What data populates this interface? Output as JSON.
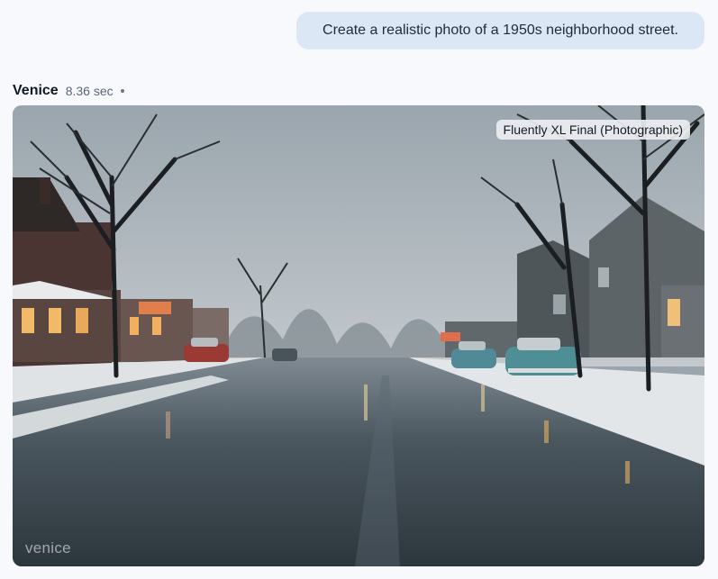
{
  "prompt": {
    "text": "Create a realistic photo of a 1950s neighborhood street."
  },
  "response": {
    "model": "Venice",
    "time": "8.36 sec",
    "image": {
      "badge": "Fluently XL Final (Photographic)",
      "watermark": "venice",
      "description_icon": "generated-photo"
    }
  },
  "colors": {
    "page_bg": "#f7f9fd",
    "bubble_bg": "#dce7f5",
    "sky": "#a3adb4",
    "road": "#3c4850"
  }
}
